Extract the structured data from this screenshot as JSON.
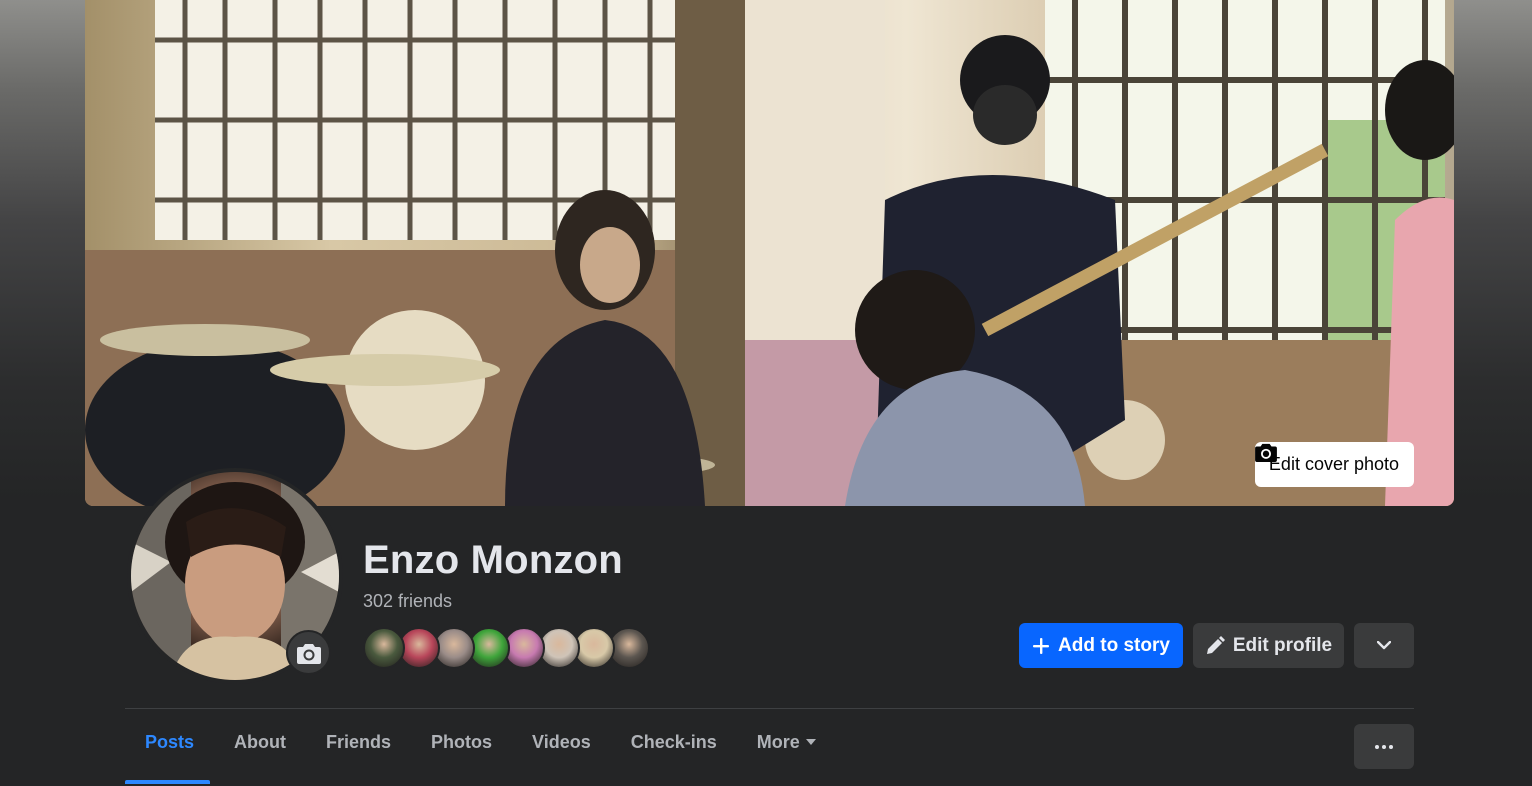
{
  "profile": {
    "name": "Enzo Monzon",
    "friends_count": "302 friends"
  },
  "cover": {
    "edit_label": "Edit cover photo",
    "icon": "camera-icon"
  },
  "friend_avatars": [
    {
      "color": "#4a5a3e"
    },
    {
      "color": "#b8465a"
    },
    {
      "color": "#9a8c88"
    },
    {
      "color": "#3fa53b"
    },
    {
      "color": "#c77ab0"
    },
    {
      "color": "#cfc4b8"
    },
    {
      "color": "#d8c9a8"
    },
    {
      "color": "#5c5650"
    }
  ],
  "actions": {
    "add_story": "Add to story",
    "edit_profile": "Edit profile",
    "more_icon": "chevron-down-icon"
  },
  "tabs": [
    {
      "label": "Posts",
      "active": true
    },
    {
      "label": "About",
      "active": false
    },
    {
      "label": "Friends",
      "active": false
    },
    {
      "label": "Photos",
      "active": false
    },
    {
      "label": "Videos",
      "active": false
    },
    {
      "label": "Check-ins",
      "active": false
    },
    {
      "label": "More",
      "active": false
    }
  ],
  "colors": {
    "background": "#242526",
    "primary": "#0866ff",
    "active_tab": "#2d88ff",
    "secondary_button": "#3a3b3c",
    "text_primary": "#e4e6eb",
    "text_secondary": "#b0b3b8"
  }
}
